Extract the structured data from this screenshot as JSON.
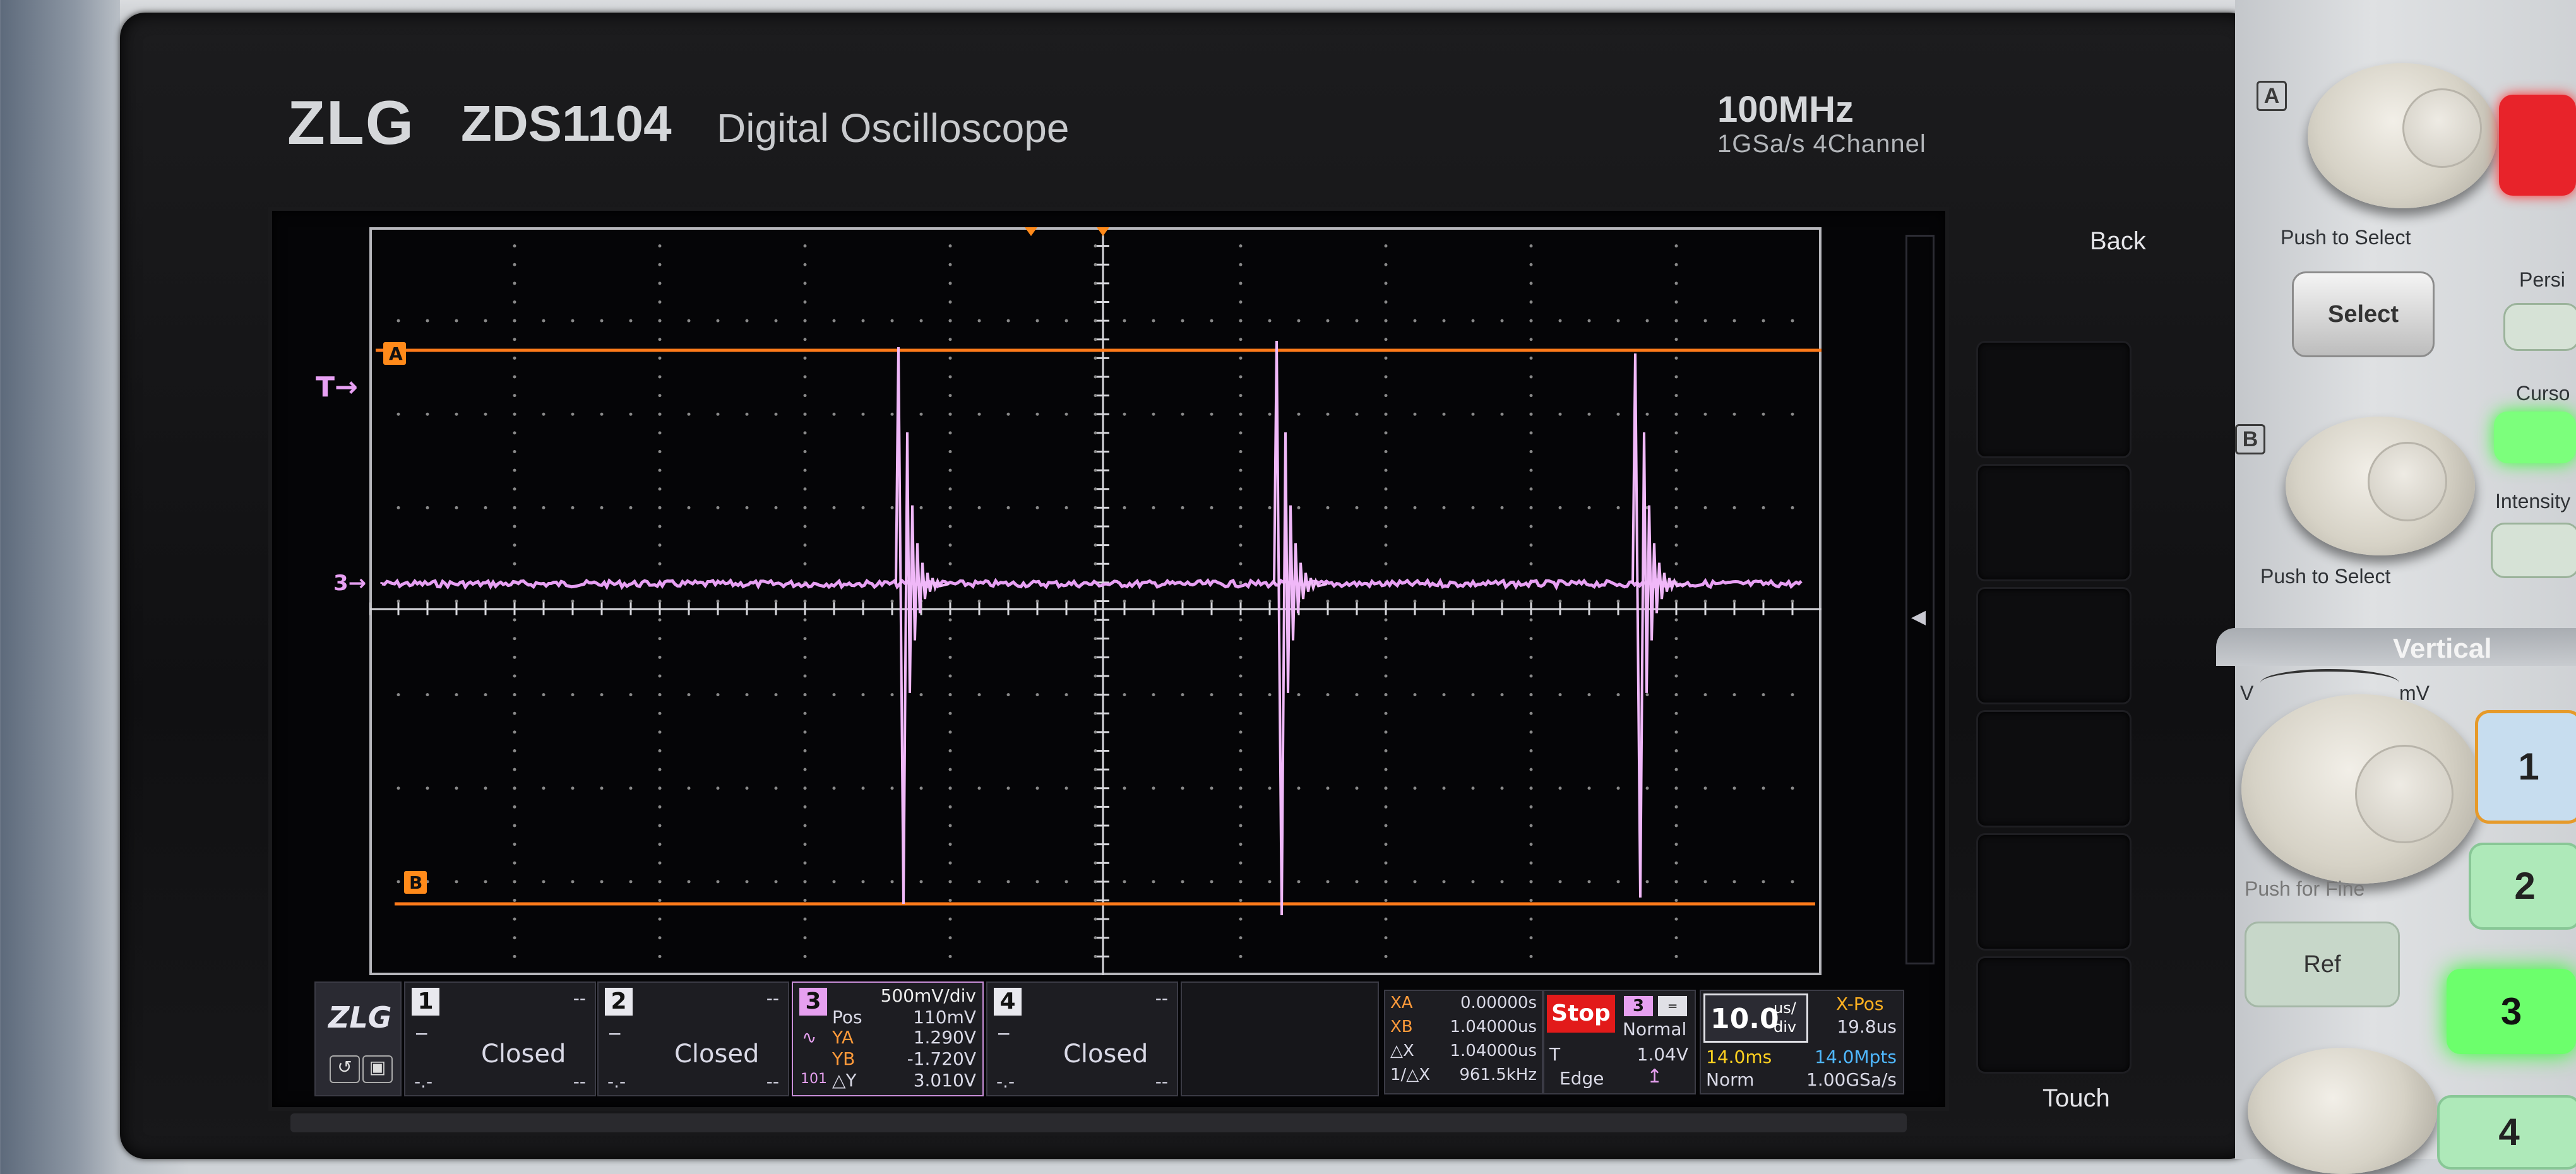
{
  "device": {
    "brand": "ZLG",
    "model": "ZDS1104",
    "subtitle": "Digital Oscilloscope",
    "bandwidth": "100MHz",
    "sample_spec": "1GSa/s  4Channel"
  },
  "screen": {
    "trigger_marker": "T",
    "channel_marker": "3",
    "cursor_a_label": "A",
    "cursor_b_label": "B",
    "colors": {
      "trace": "#e7a0f3",
      "cursor": "#ff7a1a",
      "grid": "#8a8a8a",
      "background": "#050507"
    }
  },
  "status": {
    "logo": "ZLG",
    "channels": [
      {
        "num": "1",
        "dash_top": "--",
        "state": "Closed",
        "dash_left": "-.-",
        "dash_right": "--"
      },
      {
        "num": "2",
        "dash_top": "--",
        "state": "Closed",
        "dash_left": "-.-",
        "dash_right": "--"
      },
      {
        "num": "4",
        "dash_top": "--",
        "state": "Closed",
        "dash_left": "-.-",
        "dash_right": "--"
      }
    ],
    "ch3": {
      "num": "3",
      "scale": "500mV/div",
      "pos_label": "Pos",
      "pos": "110mV",
      "ya_label": "YA",
      "ya": "1.290V",
      "yb_label": "YB",
      "yb": "-1.720V",
      "dy_label": "△Y",
      "dy": "3.010V",
      "coupling_icon": "101"
    },
    "cursors": {
      "xa_label": "XA",
      "xa": "0.00000s",
      "xb_label": "XB",
      "xb": "1.04000us",
      "dx_label": "△X",
      "dx": "1.04000us",
      "inv_label": "1/△X",
      "inv": "961.5kHz"
    },
    "run": {
      "state": "Stop",
      "trig_ch": "3",
      "mode": "Normal",
      "t_label": "T",
      "level": "1.04V",
      "type": "Edge"
    },
    "timebase": {
      "value": "10.0",
      "unit_top": "us/",
      "unit_bot": "div",
      "xpos_label": "X-Pos",
      "xpos": "19.8us",
      "memory_time": "14.0ms",
      "memory_depth": "14.0Mpts",
      "acq_mode": "Norm",
      "sample_rate": "1.00GSa/s"
    }
  },
  "softkeys": {
    "back": "Back",
    "touch": "Touch"
  },
  "controls": {
    "a_label": "A",
    "b_label": "B",
    "push_select_1": "Push to Select",
    "select": "Select",
    "persist": "Persi",
    "cursor": "Curso",
    "intensity": "Intensity",
    "push_select_2": "Push to Select",
    "vertical": "Vertical",
    "volt_v": "V",
    "volt_mv": "mV",
    "push_fine": "Push for Fine",
    "ref": "Ref",
    "ch_buttons": [
      "1",
      "2",
      "3",
      "4"
    ]
  }
}
